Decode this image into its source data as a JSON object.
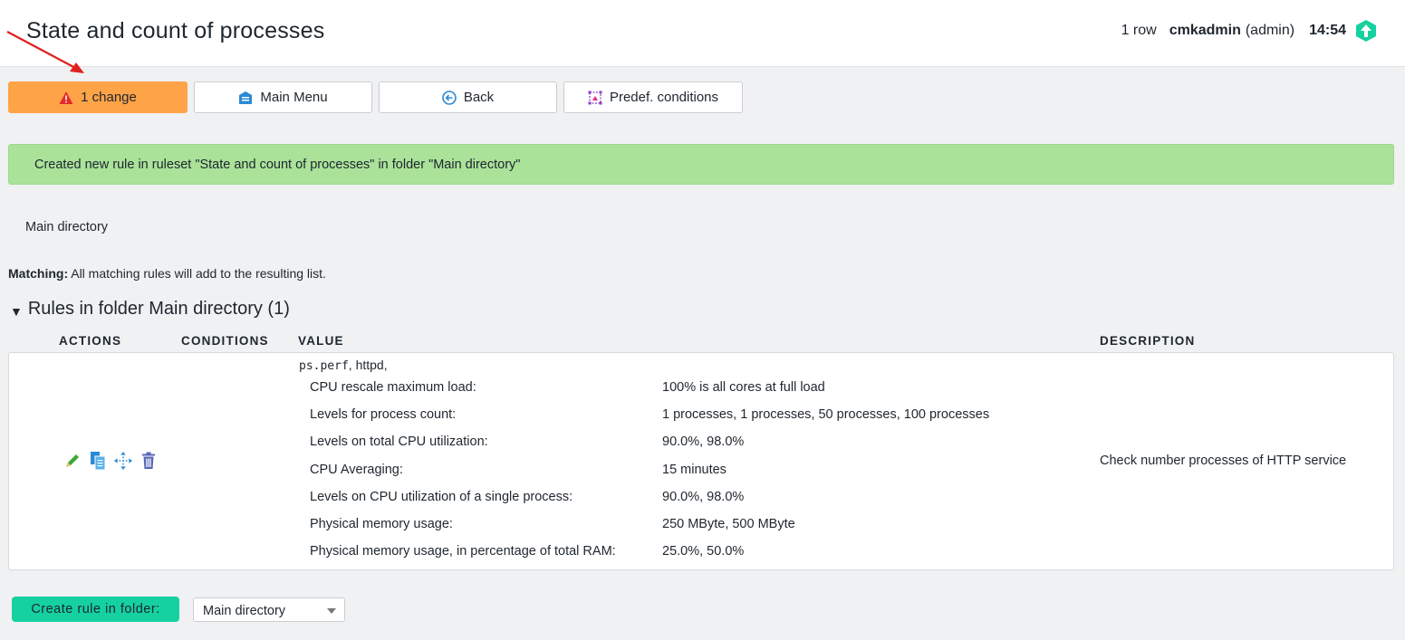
{
  "header": {
    "title": "State and count of processes",
    "row_count": "1 row",
    "user": "cmkadmin",
    "role": "(admin)",
    "time": "14:54"
  },
  "buttons": {
    "changes": "1 change",
    "main_menu": "Main Menu",
    "back": "Back",
    "predef_conditions": "Predef. conditions"
  },
  "success_message": "Created new rule in ruleset \"State and count of processes\" in folder \"Main directory\"",
  "breadcrumb": "Main directory",
  "matching": {
    "label": "Matching:",
    "text": "All matching rules will add to the resulting list."
  },
  "rules_section": {
    "title": "Rules in folder Main directory (1)",
    "columns": {
      "actions": "ACTIONS",
      "conditions": "CONDITIONS",
      "value": "VALUE",
      "description": "DESCRIPTION"
    },
    "rule": {
      "value_prefix_mono": "ps.perf",
      "value_prefix_rest": ", httpd,",
      "params": [
        {
          "key": "CPU rescale maximum load:",
          "value": "100% is all cores at full load"
        },
        {
          "key": "Levels for process count:",
          "value": "1 processes, 1 processes, 50 processes, 100 processes"
        },
        {
          "key": "Levels on total CPU utilization:",
          "value": "90.0%, 98.0%"
        },
        {
          "key": "CPU Averaging:",
          "value": "15 minutes"
        },
        {
          "key": "Levels on CPU utilization of a single process:",
          "value": "90.0%, 98.0%"
        },
        {
          "key": "Physical memory usage:",
          "value": "250 MByte, 500 MByte"
        },
        {
          "key": "Physical memory usage, in percentage of total RAM:",
          "value": "25.0%, 50.0%"
        }
      ],
      "description": "Check number processes of HTTP service"
    }
  },
  "footer": {
    "create_button": "Create rule in folder:",
    "folder_select_value": "Main directory"
  },
  "icons": {
    "header_up": "arrow-up-icon",
    "change": "warning-icon",
    "main_menu": "menu-icon",
    "back": "back-icon",
    "predef": "conditions-icon",
    "edit": "pencil-icon",
    "clone": "clone-icon",
    "move": "move-icon",
    "delete": "trash-icon"
  },
  "colors": {
    "change_button": "#ffa347",
    "success_bg": "#aae29a",
    "create_button": "#15d1a0",
    "brand_green": "#15d1a0",
    "annotation_arrow": "#e0201e"
  }
}
